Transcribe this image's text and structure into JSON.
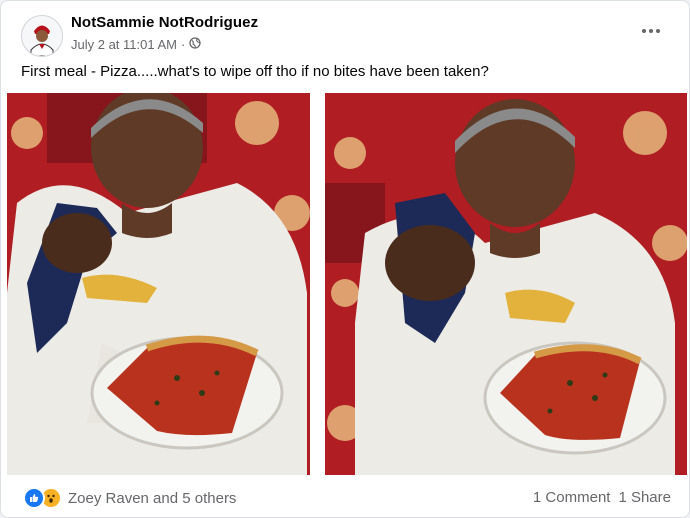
{
  "post": {
    "author": "NotSammie NotRodriguez",
    "timestamp": "July 2 at 11:01 AM",
    "separator": "·",
    "privacy_icon": "globe-icon",
    "text": "First meal - Pizza.....what's to wipe off tho if no bites have been taken?",
    "more_icon": "more-options-icon"
  },
  "footer": {
    "reaction_icons": [
      "like-icon",
      "wow-icon"
    ],
    "reactions_text": "Zoey Raven and 5 others",
    "comments": "1 Comment",
    "shares": "1 Share"
  },
  "colors": {
    "accent": "#1877f2",
    "wow": "#f7b125",
    "secondary_text": "#65676b"
  }
}
